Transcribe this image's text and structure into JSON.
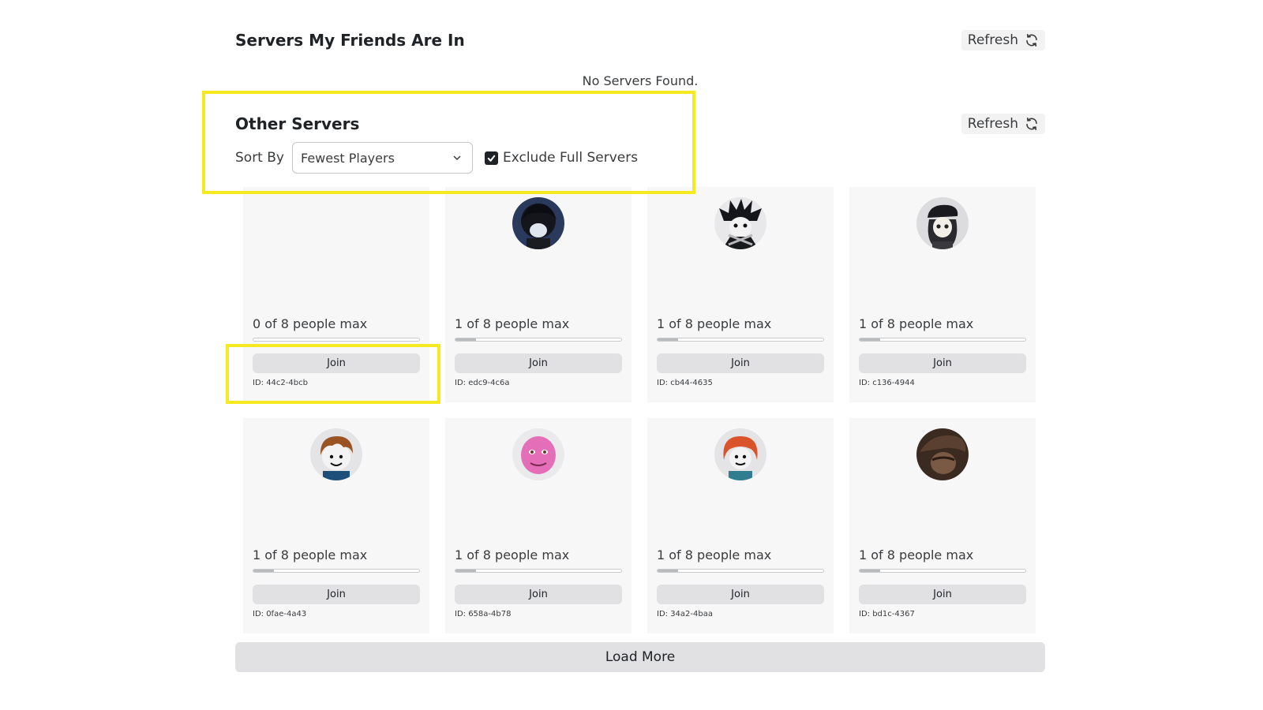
{
  "friends_section": {
    "title": "Servers My Friends Are In",
    "refresh_label": "Refresh",
    "empty_text": "No Servers Found."
  },
  "other_section": {
    "title": "Other Servers",
    "refresh_label": "Refresh",
    "sort_label": "Sort By",
    "sort_value": "Fewest Players",
    "exclude_full_label": "Exclude Full Servers",
    "exclude_full_checked": true
  },
  "servers": [
    {
      "capacity": "0 of 8 people max",
      "fill": 0,
      "join_label": "Join",
      "id": "ID: 44c2-4bcb",
      "avatar": "none"
    },
    {
      "capacity": "1 of 8 people max",
      "fill": 0.125,
      "join_label": "Join",
      "id": "ID: edc9-4c6a",
      "avatar": "dark-hair-avatar"
    },
    {
      "capacity": "1 of 8 people max",
      "fill": 0.125,
      "join_label": "Join",
      "id": "ID: cb44-4635",
      "avatar": "spiky-hair-avatar"
    },
    {
      "capacity": "1 of 8 people max",
      "fill": 0.125,
      "join_label": "Join",
      "id": "ID: c136-4944",
      "avatar": "hat-avatar"
    },
    {
      "capacity": "1 of 8 people max",
      "fill": 0.125,
      "join_label": "Join",
      "id": "ID: 0fae-4a43",
      "avatar": "brown-hair-avatar"
    },
    {
      "capacity": "1 of 8 people max",
      "fill": 0.125,
      "join_label": "Join",
      "id": "ID: 658a-4b78",
      "avatar": "pink-face-avatar"
    },
    {
      "capacity": "1 of 8 people max",
      "fill": 0.125,
      "join_label": "Join",
      "id": "ID: 34a2-4baa",
      "avatar": "red-hair-avatar"
    },
    {
      "capacity": "1 of 8 people max",
      "fill": 0.125,
      "join_label": "Join",
      "id": "ID: bd1c-4367",
      "avatar": "brown-hat-avatar"
    }
  ],
  "load_more_label": "Load More",
  "colors": {
    "highlight": "#f5ea1f",
    "card_bg": "#f7f7f8",
    "button_bg": "#e1e1e3"
  }
}
